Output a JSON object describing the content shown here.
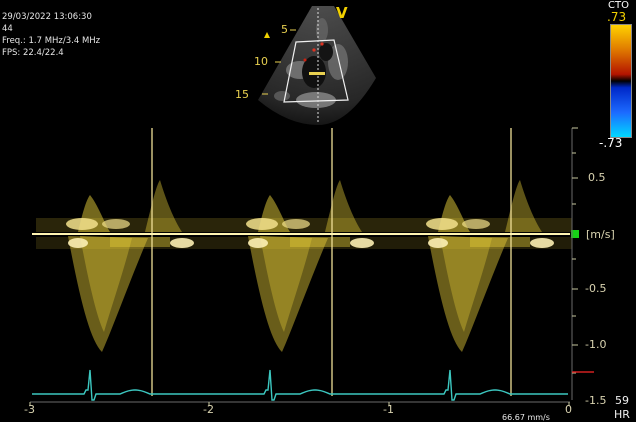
{
  "header": {
    "date_time": "29/03/2022 13:06:30",
    "frame": "44",
    "freq": "Freq.: 1.7 MHz/3.4 MHz",
    "fps": "FPS: 22.4/22.4"
  },
  "sector": {
    "marker": "V",
    "depths": [
      "5",
      "10",
      "15"
    ]
  },
  "colorbar": {
    "label": "CTO",
    "top_value": ".73",
    "bottom_value": "-.73",
    "colors": {
      "top": "#ffd200",
      "mid_top": "#b41400",
      "mid_bottom": "#0028c8",
      "bottom": "#00d8ff"
    }
  },
  "spectral": {
    "velocity_labels": [
      "0.5",
      "[m/s]",
      "-0.5",
      "-1.0",
      "-1.5"
    ],
    "time_labels": [
      "-3",
      "-2",
      "-1",
      "0"
    ],
    "sweep_speed": "66.67 mm/s",
    "hr_value": "59",
    "hr_label": "HR",
    "colors": {
      "doppler": "#e8cf3a",
      "baseline": "#fff4b0",
      "ecg": "#3cc7c0",
      "baseline_marker": "#17d017"
    }
  }
}
